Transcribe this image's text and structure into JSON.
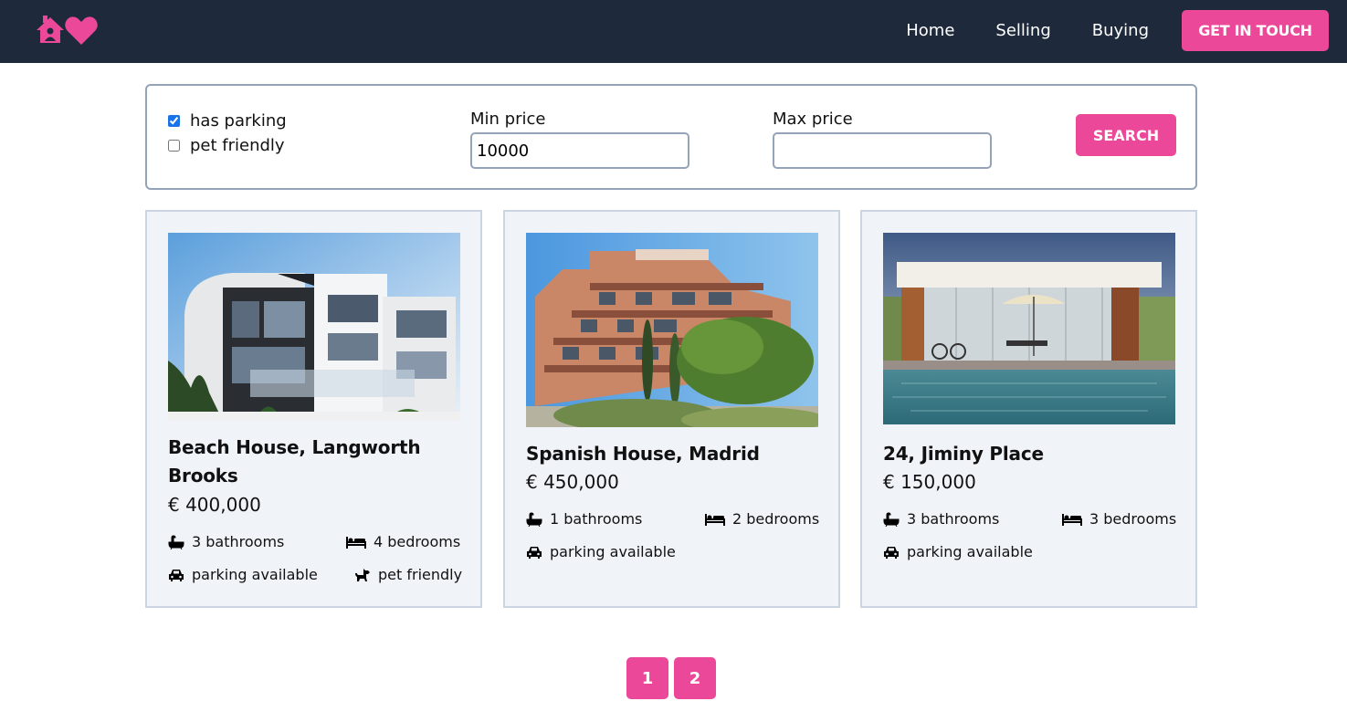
{
  "nav": {
    "links": [
      "Home",
      "Selling",
      "Buying"
    ],
    "cta_label": "GET IN TOUCH",
    "colors": {
      "background": "#1e293b",
      "accent": "#ec4899"
    }
  },
  "filters": {
    "has_parking_label": "has parking",
    "has_parking_checked": true,
    "pet_friendly_label": "pet friendly",
    "pet_friendly_checked": false,
    "min_price_label": "Min price",
    "min_price_value": "10000",
    "max_price_label": "Max price",
    "max_price_value": "",
    "search_label": "SEARCH"
  },
  "listings": [
    {
      "title": "Beach House, Langworth Brooks",
      "price": "€ 400,000",
      "bathrooms": "3 bathrooms",
      "bedrooms": "4 bedrooms",
      "parking": "parking available",
      "pets": "pet friendly"
    },
    {
      "title": "Spanish House, Madrid",
      "price": "€ 450,000",
      "bathrooms": "1 bathrooms",
      "bedrooms": "2 bedrooms",
      "parking": "parking available"
    },
    {
      "title": "24, Jiminy Place",
      "price": "€ 150,000",
      "bathrooms": "3 bathrooms",
      "bedrooms": "3 bedrooms",
      "parking": "parking available"
    }
  ],
  "pagination": {
    "pages": [
      "1",
      "2"
    ]
  },
  "icons": [
    "logo-house-heart-icon",
    "bath-icon",
    "bed-icon",
    "car-icon",
    "dog-icon"
  ]
}
